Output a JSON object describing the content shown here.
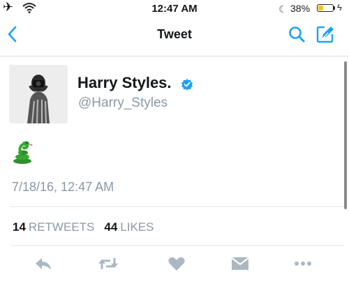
{
  "status_bar": {
    "time": "12:47 AM",
    "battery_percent": "38%",
    "battery_level": 0.38,
    "icons": [
      "airplane-mode-icon",
      "wifi-icon",
      "moon-icon",
      "battery-icon",
      "charging-bolt-icon"
    ]
  },
  "nav": {
    "title": "Tweet",
    "icons": [
      "back-chevron-icon",
      "search-icon",
      "compose-icon"
    ]
  },
  "tweet": {
    "author_name": "Harry Styles.",
    "author_handle": "@Harry_Styles",
    "verified": true,
    "body_emoji": "snake",
    "timestamp": "7/18/16, 12:47 AM",
    "retweets": {
      "count": "14",
      "label": "RETWEETS"
    },
    "likes": {
      "count": "44",
      "label": "LIKES"
    }
  },
  "actions": [
    "reply-icon",
    "retweet-icon",
    "like-icon",
    "direct-message-icon",
    "more-icon"
  ],
  "colors": {
    "accent": "#1da1f2",
    "muted_text": "#8899a6",
    "action_icons": "#aab8c2",
    "battery_fill": "#f5c518",
    "snake_green": "#3aa635"
  }
}
